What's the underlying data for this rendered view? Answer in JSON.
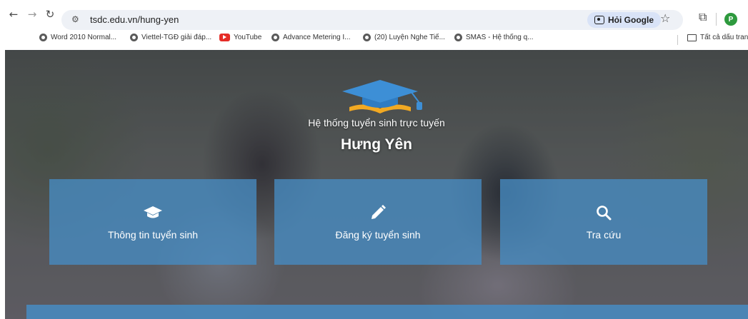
{
  "browser": {
    "url": "tsdc.edu.vn/hung-yen",
    "ask_google_label": "Hỏi Google",
    "profile_initial": "P",
    "bookmarks": [
      {
        "label": "Word 2010 Normal...",
        "icon": "globe-icon"
      },
      {
        "label": "Viettel-TGĐ giải đáp...",
        "icon": "globe-icon"
      },
      {
        "label": "YouTube",
        "icon": "youtube-icon"
      },
      {
        "label": "Advance Metering I...",
        "icon": "globe-icon"
      },
      {
        "label": "(20) Luyện Nghe Tiế...",
        "icon": "globe-icon"
      },
      {
        "label": "SMAS - Hệ thống q...",
        "icon": "globe-icon"
      }
    ],
    "all_bookmarks_label": "Tất cả dấu tran"
  },
  "hero": {
    "subtitle": "Hệ thống tuyển sinh trực tuyến",
    "title": "Hưng Yên"
  },
  "tiles": [
    {
      "label": "Thông tin tuyển sinh",
      "icon": "graduation-cap-icon"
    },
    {
      "label": "Đăng ký tuyển sinh",
      "icon": "pencil-icon"
    },
    {
      "label": "Tra cứu",
      "icon": "search-icon"
    }
  ],
  "colors": {
    "tile": "#468cc3",
    "cap": "#3d8fd6",
    "book": "#f2a922"
  }
}
